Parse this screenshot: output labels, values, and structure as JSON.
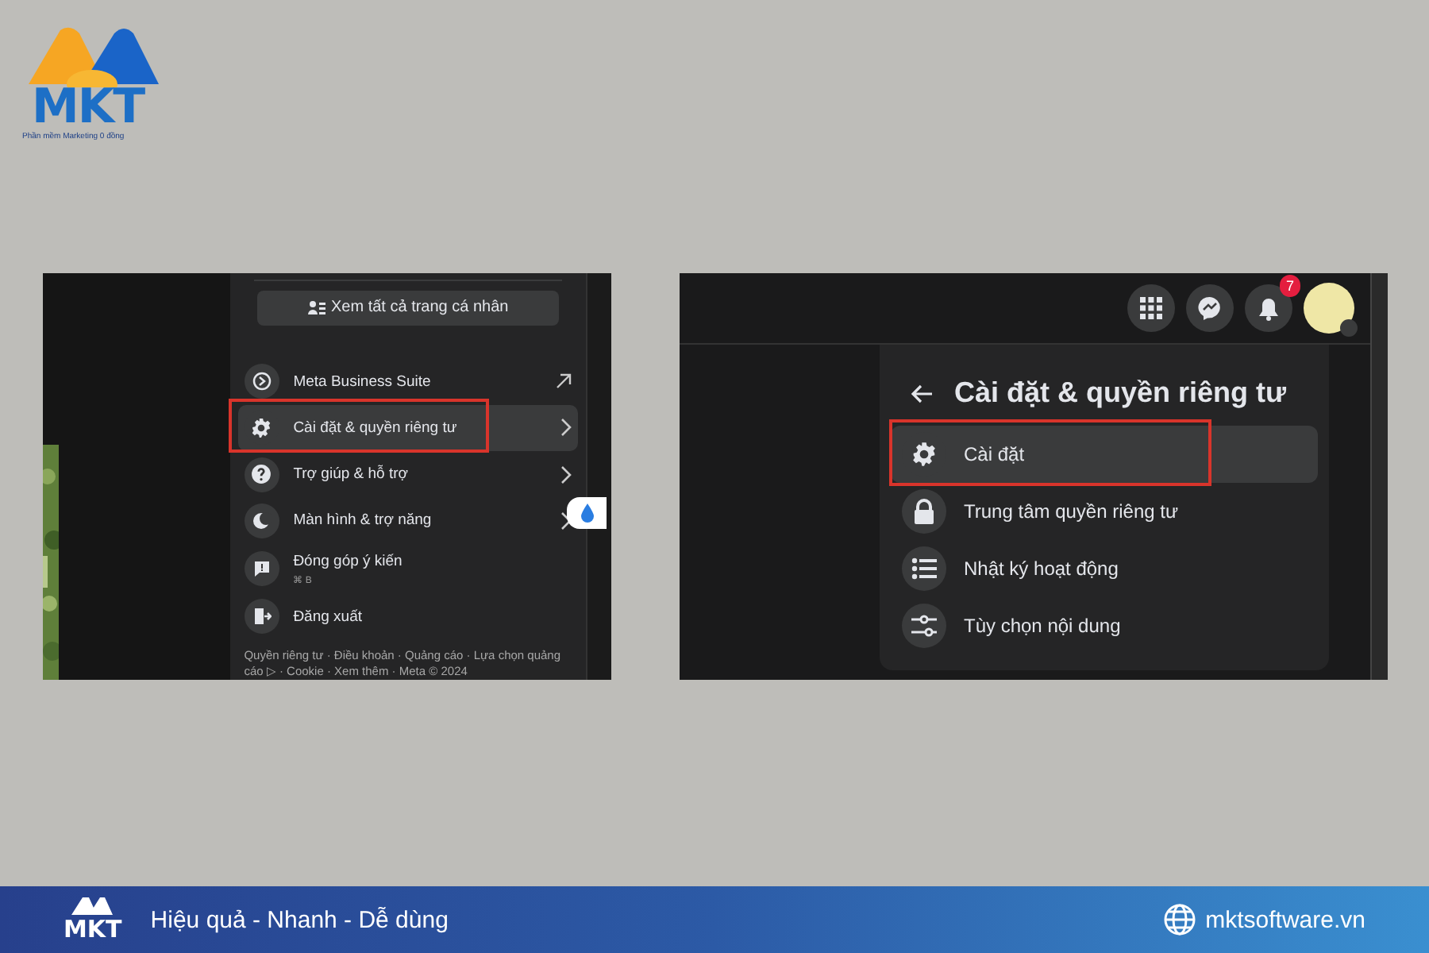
{
  "logo": {
    "name": "MKT",
    "tagline": "Phần mềm Marketing 0 đồng"
  },
  "left_panel": {
    "view_all_button": "Xem tất cả trang cá nhân",
    "items": [
      {
        "kind": "link",
        "label": "Meta Business Suite",
        "selected": false,
        "outlined": false
      },
      {
        "kind": "submenu",
        "label": "Cài đặt & quyền riêng tư",
        "selected": true,
        "outlined": true
      },
      {
        "kind": "submenu",
        "label": "Trợ giúp & hỗ trợ",
        "selected": false,
        "outlined": false
      },
      {
        "kind": "submenu",
        "label": "Màn hình & trợ năng",
        "selected": false,
        "outlined": false
      },
      {
        "kind": "plain",
        "label": "Đóng góp ý kiến",
        "shortcut": "⌘ B",
        "selected": false,
        "outlined": false
      },
      {
        "kind": "plain",
        "label": "Đăng xuất",
        "selected": false,
        "outlined": false
      }
    ],
    "footer_links": "Quyền riêng tư · Điều khoản · Quảng cáo · Lựa chọn quảng cáo ▷ · Cookie · Xem thêm · Meta © 2024"
  },
  "right_panel": {
    "notification_badge": "7",
    "title": "Cài đặt & quyền riêng tư",
    "items": [
      {
        "label": "Cài đặt",
        "selected": true,
        "outlined": true
      },
      {
        "label": "Trung tâm quyền riêng tư",
        "selected": false,
        "outlined": false
      },
      {
        "label": "Nhật ký hoạt động",
        "selected": false,
        "outlined": false
      },
      {
        "label": "Tùy chọn nội dung",
        "selected": false,
        "outlined": false
      }
    ]
  },
  "footer": {
    "logo": "MKT",
    "slogan": "Hiệu quả - Nhanh - Dễ dùng",
    "website": "mktsoftware.vn"
  }
}
